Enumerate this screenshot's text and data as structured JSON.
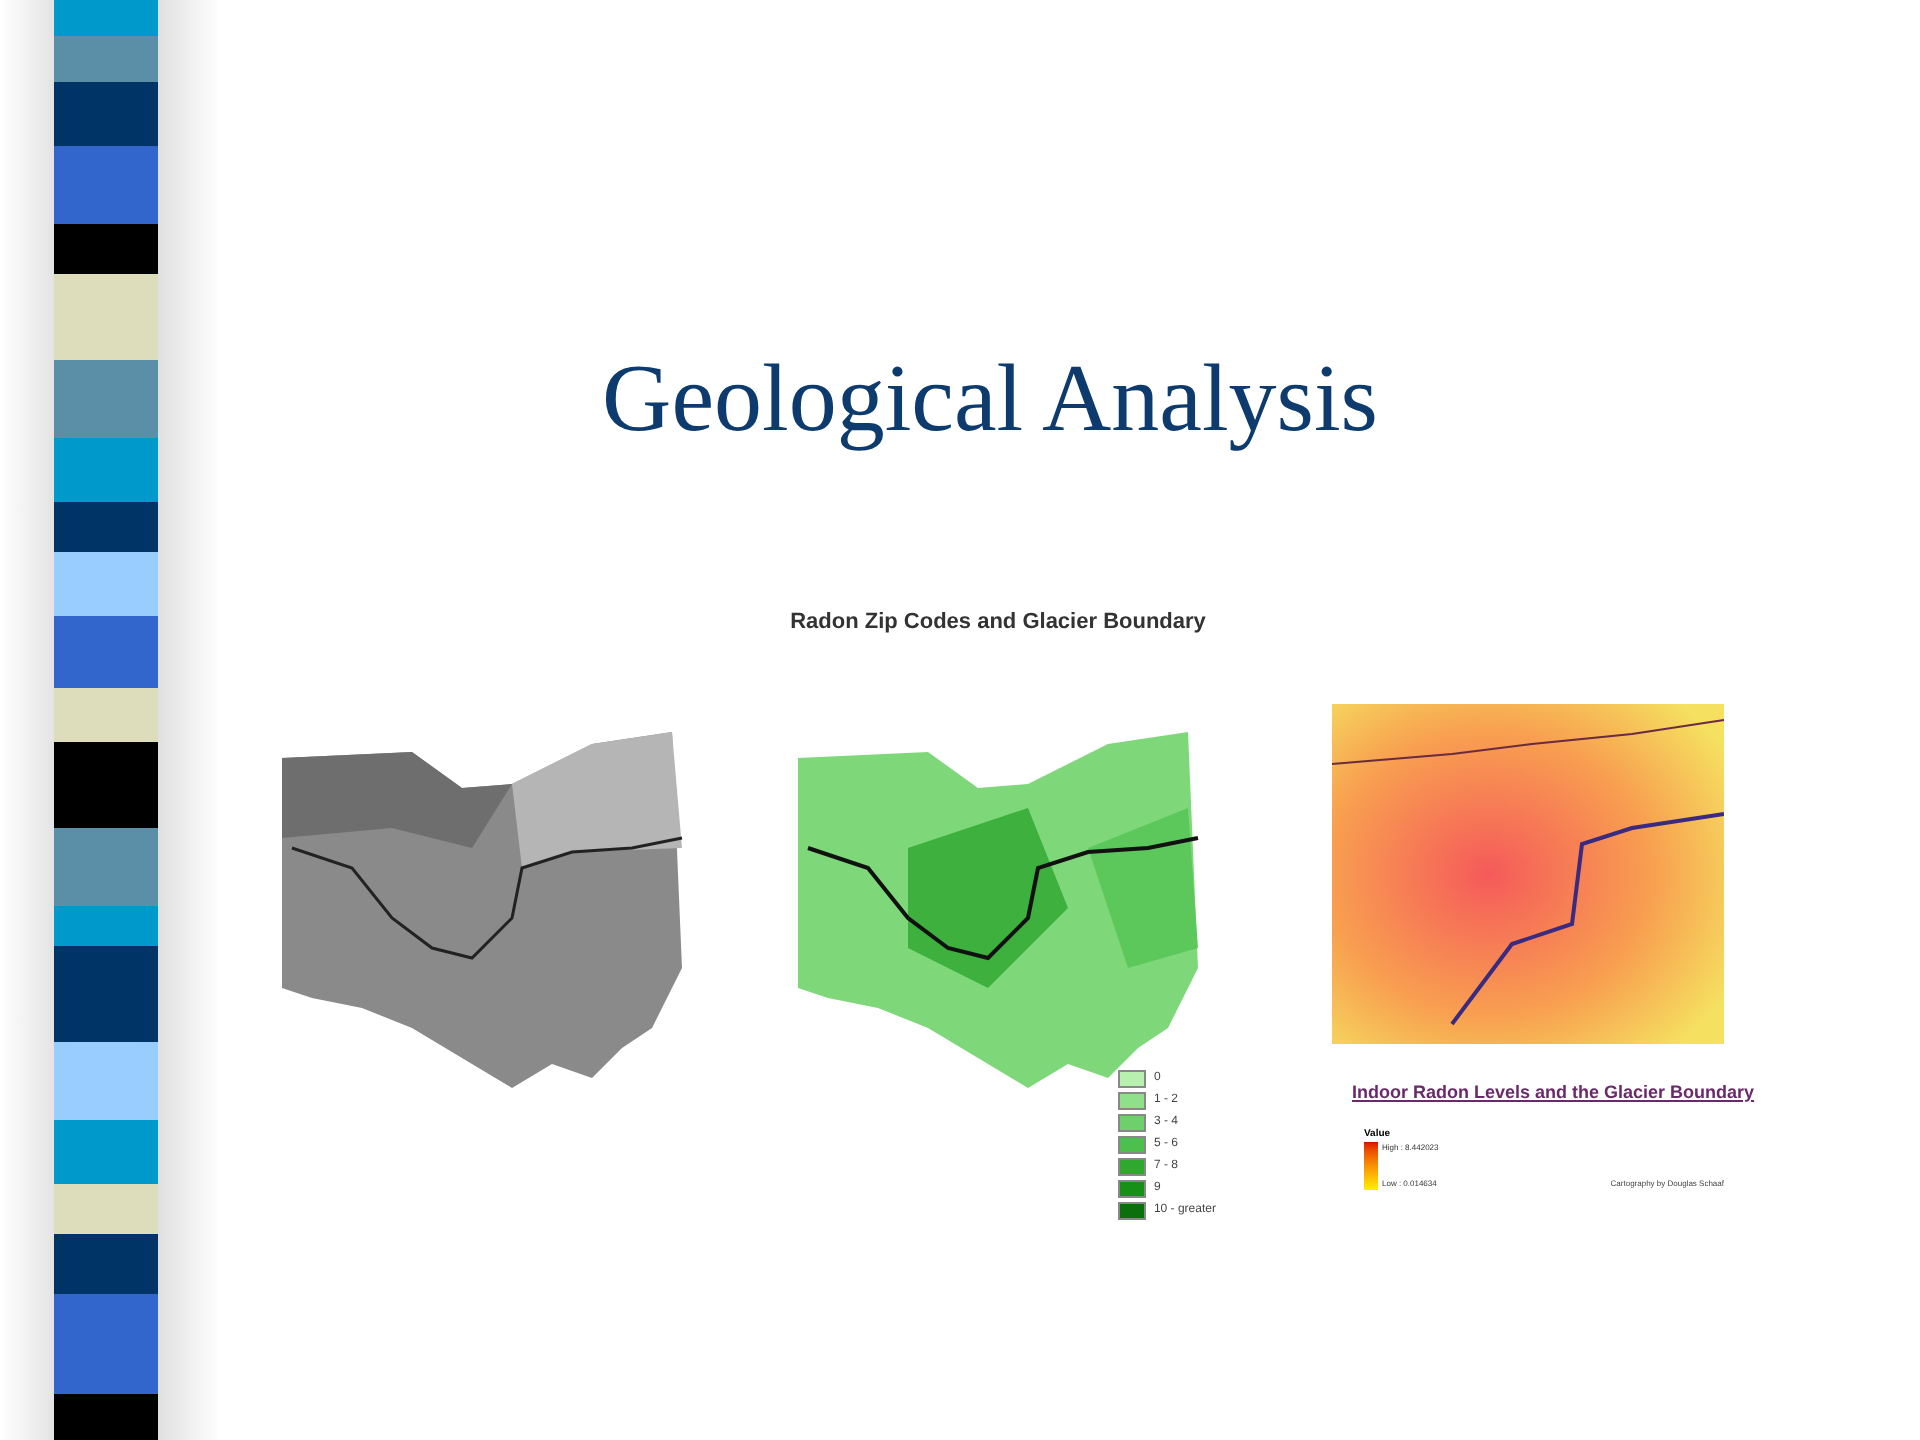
{
  "slide": {
    "title": "Geological Analysis"
  },
  "maps": [
    {
      "kind": "relief"
    },
    {
      "kind": "zip",
      "title": "Radon Zip Codes and Glacier Boundary",
      "legend": [
        {
          "label": "0",
          "color": "#b8f0b0"
        },
        {
          "label": "1 - 2",
          "color": "#8fe08a"
        },
        {
          "label": "3 - 4",
          "color": "#6ed06a"
        },
        {
          "label": "5 - 6",
          "color": "#4cbf4c"
        },
        {
          "label": "7 - 8",
          "color": "#2ea82e"
        },
        {
          "label": "9",
          "color": "#169016"
        },
        {
          "label": "10 - greater",
          "color": "#0b700b"
        }
      ]
    },
    {
      "kind": "heat",
      "title": "Indoor Radon Levels and the Glacier Boundary",
      "legend_title": "Value",
      "high": "High : 8.442023",
      "low": "Low : 0.014634",
      "credit": "Cartography by Douglas Schaaf"
    }
  ]
}
